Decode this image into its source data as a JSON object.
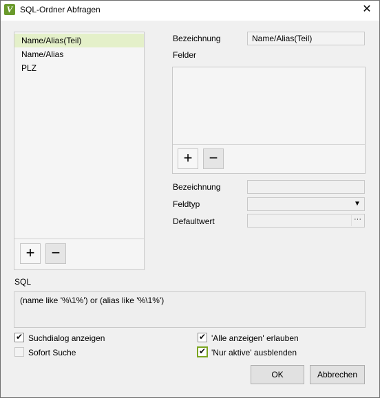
{
  "window": {
    "title": "SQL-Ordner Abfragen",
    "close_glyph": "✕",
    "app_icon_glyph": "V"
  },
  "queries": {
    "items": [
      {
        "label": "Name/Alias(Teil)",
        "selected": true
      },
      {
        "label": "Name/Alias",
        "selected": false
      },
      {
        "label": "PLZ",
        "selected": false
      }
    ],
    "add_glyph": "+",
    "remove_glyph": "−"
  },
  "detail": {
    "bezeichnung_label": "Bezeichnung",
    "bezeichnung_value": "Name/Alias(Teil)",
    "felder_label": "Felder",
    "felder_add_glyph": "+",
    "felder_remove_glyph": "−",
    "field_bezeichnung_label": "Bezeichnung",
    "field_bezeichnung_value": "",
    "feldtyp_label": "Feldtyp",
    "feldtyp_value": "",
    "feldtyp_arrow": "▼",
    "defaultwert_label": "Defaultwert",
    "defaultwert_value": "",
    "defaultwert_button": "···"
  },
  "sql": {
    "label": "SQL",
    "text": "(name like '%\\1%') or (alias like '%\\1%')"
  },
  "options": {
    "suchdialog": {
      "label": "Suchdialog anzeigen",
      "checked": true
    },
    "sofort": {
      "label": "Sofort Suche",
      "checked": false
    },
    "alle_anzeigen": {
      "label": "'Alle anzeigen' erlauben",
      "checked": true
    },
    "nur_aktive": {
      "label": "'Nur aktive' ausblenden",
      "checked": true
    }
  },
  "buttons": {
    "ok": "OK",
    "cancel": "Abbrechen"
  },
  "colors": {
    "accent": "#7aa51f",
    "selection": "#e4f0c9",
    "app_icon": "#6a9a2c"
  }
}
